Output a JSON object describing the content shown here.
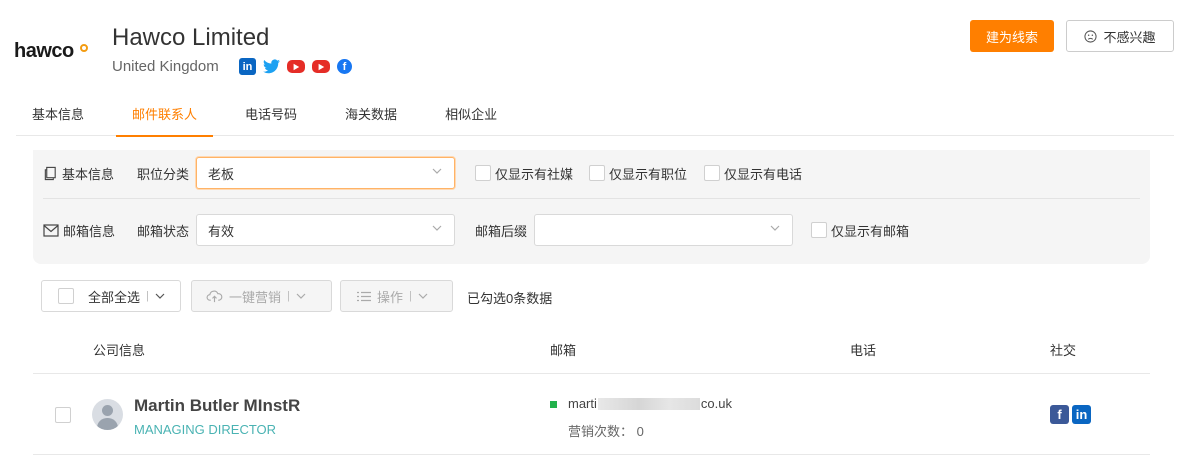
{
  "header": {
    "logo_text": "hawco",
    "company_name": "Hawco Limited",
    "country": "United Kingdom",
    "socials": [
      "linkedin-icon",
      "twitter-icon",
      "youtube-icon",
      "youtube-icon",
      "facebook-icon"
    ],
    "create_lead_label": "建为线索",
    "not_interested_label": "不感兴趣"
  },
  "tabs": [
    {
      "label": "基本信息",
      "active": false
    },
    {
      "label": "邮件联系人",
      "active": true
    },
    {
      "label": "电话号码",
      "active": false
    },
    {
      "label": "海关数据",
      "active": false
    },
    {
      "label": "相似企业",
      "active": false
    }
  ],
  "filters": {
    "basic_info_label": "基本信息",
    "position_label": "职位分类",
    "position_value": "老板",
    "only_social_label": "仅显示有社媒",
    "only_position_label": "仅显示有职位",
    "only_phone_label": "仅显示有电话",
    "email_info_label": "邮箱信息",
    "email_status_label": "邮箱状态",
    "email_status_value": "有效",
    "email_suffix_label": "邮箱后缀",
    "email_suffix_value": "",
    "only_email_label": "仅显示有邮箱"
  },
  "toolbar": {
    "select_all_label": "全部全选",
    "one_click_marketing_label": "一键营销",
    "operations_label": "操作",
    "selected_count_text": "已勾选0条数据"
  },
  "table": {
    "headers": [
      "公司信息",
      "邮箱",
      "电话",
      "社交"
    ],
    "rows": [
      {
        "name": "Martin Butler MInstR",
        "title": "MANAGING DIRECTOR",
        "email_prefix": "marti",
        "email_suffix": "co.uk",
        "marketing_count_label": "营销次数：",
        "marketing_count": "0",
        "email_status_color": "#22b24c",
        "socials": [
          "facebook-icon",
          "linkedin-icon"
        ]
      }
    ]
  },
  "colors": {
    "accent": "#ff7f00",
    "title_teal": "#4ab3b3"
  }
}
